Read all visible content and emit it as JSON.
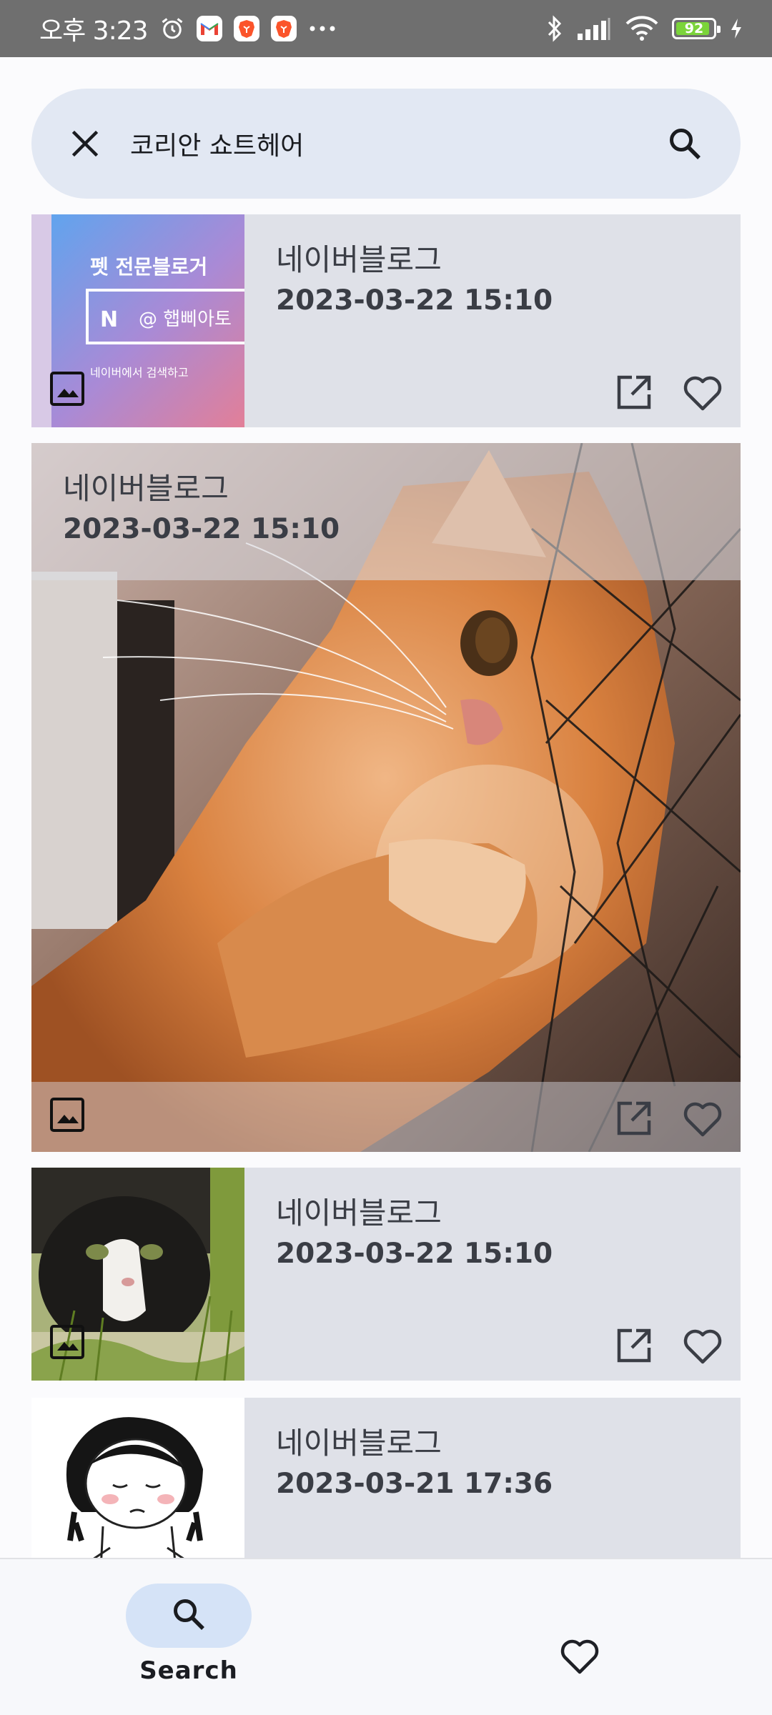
{
  "status_bar": {
    "time": "오후 3:23",
    "battery": "92",
    "battery_level_percent": 92,
    "icons": [
      "alarm-icon",
      "gmail-icon",
      "brave-icon",
      "brave-icon",
      "more-icon",
      "bluetooth-icon",
      "signal-icon",
      "wifi-icon",
      "battery-icon",
      "charging-icon"
    ]
  },
  "search": {
    "query": "코리안 쇼트헤어"
  },
  "results": [
    {
      "title": "네이버블로그",
      "date": "2023-03-22 15:10",
      "thumb_text_1": "펫 전문블로거",
      "thumb_text_2": "@ 햅삐아토",
      "thumb_text_3": "네이버에서 검색하고"
    },
    {
      "title": "네이버블로그",
      "date": "2023-03-22 15:10"
    },
    {
      "title": "네이버블로그",
      "date": "2023-03-22 15:10"
    },
    {
      "title": "네이버블로그",
      "date": "2023-03-21 17:36"
    }
  ],
  "bottom_nav": {
    "search_label": "Search"
  },
  "colors": {
    "search_bg": "#e2e8f3",
    "card_bg": "#dfe1e8",
    "nav_active": "#d5e3f7",
    "status_bar": "#6f6f6f",
    "battery_fill": "#7bd43a"
  }
}
